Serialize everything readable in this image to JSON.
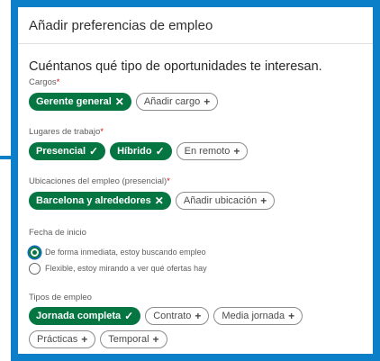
{
  "modal": {
    "title": "Añadir preferencias de empleo"
  },
  "intro": "Cuéntanos qué tipo de oportunidades te interesan.",
  "cargos": {
    "label": "Cargos",
    "required_mark": "*",
    "selected": [
      {
        "label": "Gerente general",
        "icon": "close-icon"
      }
    ],
    "add": {
      "label": "Añadir cargo",
      "icon": "plus-icon"
    }
  },
  "lugares": {
    "label": "Lugares de trabajo",
    "required_mark": "*",
    "selected": [
      {
        "label": "Presencial",
        "icon": "check-icon"
      },
      {
        "label": "Híbrido",
        "icon": "check-icon"
      }
    ],
    "add": {
      "label": "En remoto",
      "icon": "plus-icon"
    }
  },
  "ubicaciones": {
    "label": "Ubicaciones del empleo (presencial)",
    "required_mark": "*",
    "selected": [
      {
        "label": "Barcelona y alrededores",
        "icon": "close-icon"
      }
    ],
    "add": {
      "label": "Añadir ubicación",
      "icon": "plus-icon"
    }
  },
  "fecha": {
    "label": "Fecha de inicio",
    "options": [
      {
        "label": "De forma inmediata, estoy buscando empleo",
        "checked": true
      },
      {
        "label": "Flexible, estoy mirando a ver qué ofertas hay",
        "checked": false
      }
    ]
  },
  "tipos": {
    "label": "Tipos de empleo",
    "selected": [
      {
        "label": "Jornada completa",
        "icon": "check-icon"
      }
    ],
    "add": [
      {
        "label": "Contrato",
        "icon": "plus-icon"
      },
      {
        "label": "Media jornada",
        "icon": "plus-icon"
      },
      {
        "label": "Prácticas",
        "icon": "plus-icon"
      },
      {
        "label": "Temporal",
        "icon": "plus-icon"
      }
    ]
  },
  "colors": {
    "selected_green": "#057642",
    "frame_blue": "#0b7fc7",
    "required_red": "#cc1016"
  }
}
